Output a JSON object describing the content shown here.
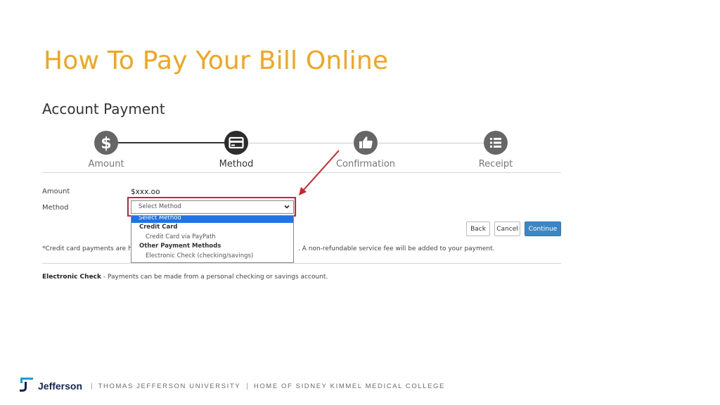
{
  "slide": {
    "title": "How To Pay Your Bill Online"
  },
  "page": {
    "title": "Account Payment"
  },
  "stepper": {
    "steps": [
      {
        "label": "Amount",
        "icon": "dollar-icon",
        "state": "complete"
      },
      {
        "label": "Method",
        "icon": "credit-card-icon",
        "state": "active"
      },
      {
        "label": "Confirmation",
        "icon": "thumbs-up-icon",
        "state": "pending"
      },
      {
        "label": "Receipt",
        "icon": "list-icon",
        "state": "pending"
      }
    ]
  },
  "form": {
    "amount_label": "Amount",
    "amount_value": "$xxx.oo",
    "method_label": "Method",
    "method_select": {
      "value": "Select Method",
      "options": [
        {
          "label": "Select Method",
          "kind": "selected"
        },
        {
          "label": "Credit Card",
          "kind": "group"
        },
        {
          "label": "Credit Card via PayPath",
          "kind": "option"
        },
        {
          "label": "Other Payment Methods",
          "kind": "group"
        },
        {
          "label": "Electronic Check (checking/savings)",
          "kind": "option"
        }
      ]
    }
  },
  "buttons": {
    "back": "Back",
    "cancel": "Cancel",
    "continue": "Continue"
  },
  "notes": {
    "credit_card_start": "*Credit card payments are ha",
    "credit_card_end": ". A non-refundable service fee will be added to your payment.",
    "echeck_bold": "Electronic Check",
    "echeck_text": " - Payments can be made from a personal checking or savings account."
  },
  "footer": {
    "brand": "Jefferson",
    "university": "THOMAS JEFFERSON UNIVERSITY",
    "tagline": "HOME OF SIDNEY KIMMEL MEDICAL COLLEGE",
    "separator": "|"
  },
  "colors": {
    "title": "#f2a51e",
    "highlight": "#d3232a",
    "primary_button": "#3d86c6",
    "selected_option": "#1e73e8",
    "brand": "#152456"
  }
}
